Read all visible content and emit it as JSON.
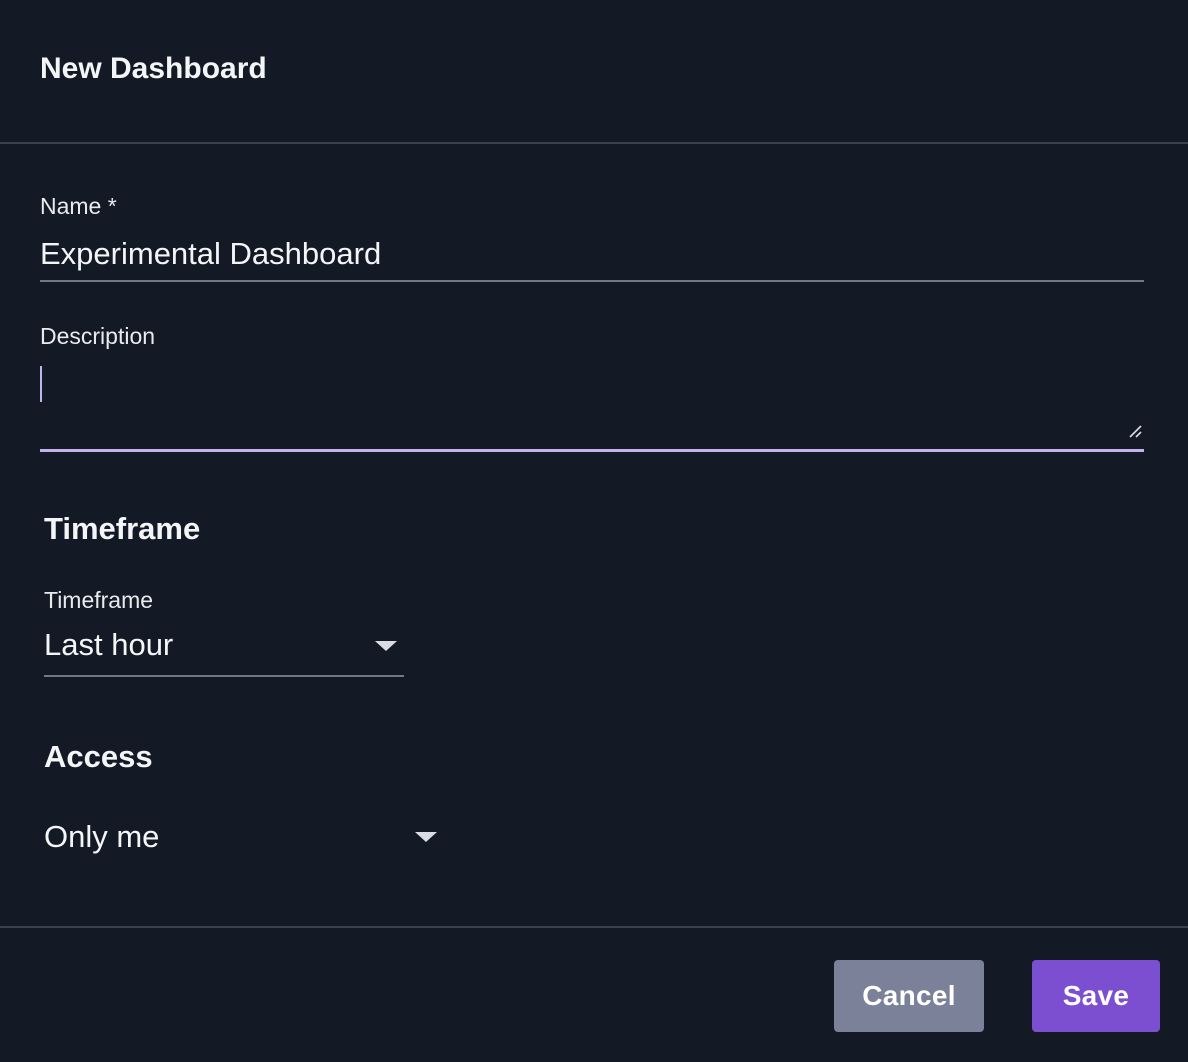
{
  "dialog": {
    "title": "New Dashboard"
  },
  "form": {
    "name": {
      "label": "Name *",
      "value": "Experimental Dashboard"
    },
    "description": {
      "label": "Description",
      "value": ""
    },
    "timeframe_section": {
      "heading": "Timeframe",
      "field_label": "Timeframe",
      "selected": "Last hour"
    },
    "access_section": {
      "heading": "Access",
      "selected": "Only me"
    }
  },
  "footer": {
    "cancel_label": "Cancel",
    "save_label": "Save"
  },
  "colors": {
    "background": "#141a25",
    "divider": "#3a404c",
    "focus_accent": "#c2b2ee",
    "cancel_button": "#7a8199",
    "save_button": "#7b4fcf"
  },
  "icons": {
    "select_arrow": "chevron-down-icon",
    "textarea_resize": "resize-handle-icon"
  }
}
